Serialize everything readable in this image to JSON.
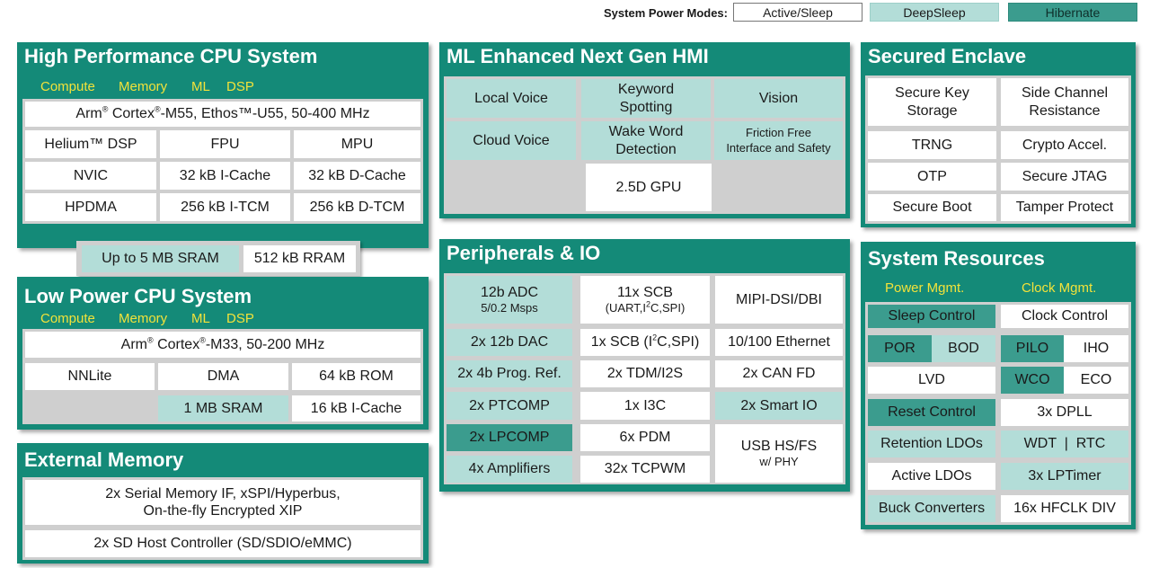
{
  "legend": {
    "label": "System Power Modes:",
    "active": "Active/Sleep",
    "deep": "DeepSleep",
    "hibernate": "Hibernate"
  },
  "colors": {
    "panel": "#148a78",
    "active_sleep": "#ffffff",
    "deep_sleep": "#b3ddd8",
    "hibernate": "#3b9c8e",
    "subtitle": "#f2e23a"
  },
  "hp_cpu": {
    "title": "High Performance CPU System",
    "sub": [
      "Compute",
      "Memory",
      "ML",
      "DSP"
    ],
    "core": {
      "pre": "Arm",
      "sup": "®",
      "post": " Cortex",
      "sup2": "®",
      "post2": "-M55, Ethos™-U55, 50-400 MHz"
    },
    "cells": [
      "Helium™ DSP",
      "FPU",
      "MPU",
      "NVIC",
      "32 kB I-Cache",
      "32 kB D-Cache",
      "HPDMA",
      "256 kB I-TCM",
      "256 kB D-TCM"
    ]
  },
  "shared_mem": {
    "sram": "Up to 5 MB SRAM",
    "rram": "512 kB RRAM"
  },
  "lp_cpu": {
    "title": "Low Power CPU System",
    "sub": [
      "Compute",
      "Memory",
      "ML",
      "DSP"
    ],
    "core": {
      "pre": "Arm",
      "sup": "®",
      "post": " Cortex",
      "sup2": "®",
      "post2": "-M33, 50-200 MHz"
    },
    "cells": [
      "NNLite",
      "DMA",
      "64 kB ROM",
      "1 MB SRAM",
      "16 kB I-Cache"
    ]
  },
  "ext_mem": {
    "title": "External Memory",
    "line1": "2x Serial Memory IF, xSPI/Hyperbus,",
    "line2": "On-the-fly Encrypted XIP",
    "sd": "2x SD Host Controller (SD/SDIO/eMMC)"
  },
  "hmi": {
    "title": "ML Enhanced Next Gen HMI",
    "local_voice": "Local Voice",
    "kws1": "Keyword",
    "kws2": "Spotting",
    "vision": "Vision",
    "cloud_voice": "Cloud Voice",
    "wwd1": "Wake Word",
    "wwd2": "Detection",
    "ff1": "Friction Free",
    "ff2": "Interface and Safety",
    "gpu": "2.5D GPU"
  },
  "periph": {
    "title": "Peripherals & IO",
    "adc1": "12b ADC",
    "adc2": "5/0.2 Msps",
    "scb1": "11x SCB",
    "scb2": {
      "pre": "(UART,I",
      "sup": "2",
      "post": "C,SPI)"
    },
    "mipi": "MIPI-DSI/DBI",
    "dac": "2x 12b DAC",
    "scb1x": {
      "pre": "1x SCB (I",
      "sup": "2",
      "post": "C,SPI)"
    },
    "eth": "10/100 Ethernet",
    "ref": "2x 4b Prog. Ref.",
    "tdm": "2x TDM/I2S",
    "can": "2x CAN FD",
    "ptcomp": "2x PTCOMP",
    "i3c": "1x I3C",
    "smartio": "2x Smart IO",
    "lpcomp": "2x LPCOMP",
    "pdm": "6x PDM",
    "usb1": "USB HS/FS",
    "usb2": "w/ PHY",
    "amp": "4x Amplifiers",
    "tcpwm": "32x TCPWM"
  },
  "secure": {
    "title": "Secured Enclave",
    "key1": "Secure Key",
    "key2": "Storage",
    "sc1": "Side Channel",
    "sc2": "Resistance",
    "trng": "TRNG",
    "crypto": "Crypto Accel.",
    "otp": "OTP",
    "jtag": "Secure JTAG",
    "boot": "Secure Boot",
    "tamper": "Tamper Protect"
  },
  "sysres": {
    "title": "System Resources",
    "power": "Power Mgmt.",
    "clock": "Clock Mgmt.",
    "sleep": "Sleep Control",
    "clkctl": "Clock Control",
    "por": "POR",
    "bod": "BOD",
    "pilo": "PILO",
    "iho": "IHO",
    "lvd": "LVD",
    "wco": "WCO",
    "eco": "ECO",
    "reset": "Reset Control",
    "dpll": "3x DPLL",
    "retldo": "Retention LDOs",
    "wdt": "WDT  |  RTC",
    "actldo": "Active LDOs",
    "lptimer": "3x LPTimer",
    "buck": "Buck Converters",
    "hfclk": "16x HFCLK DIV"
  }
}
